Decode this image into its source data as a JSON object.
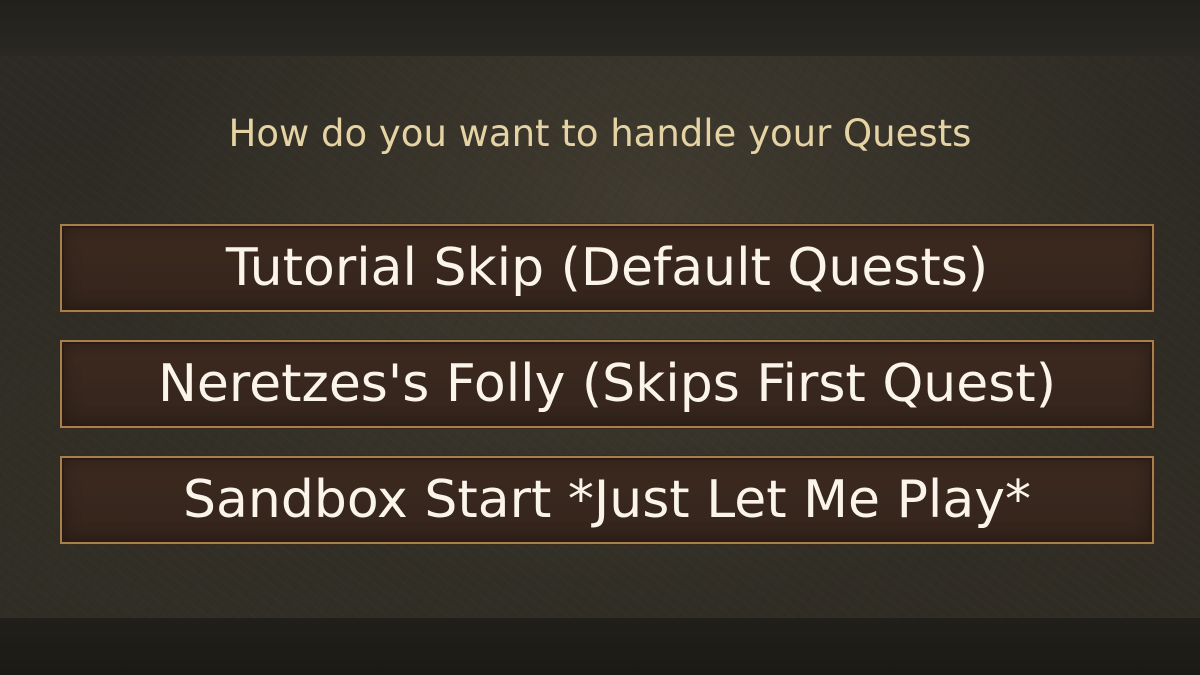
{
  "dialog": {
    "prompt": "How do you want to handle your Quests",
    "options": [
      {
        "label": "Tutorial Skip (Default Quests)"
      },
      {
        "label": "Neretzes's Folly (Skips First Quest)"
      },
      {
        "label": "Sandbox Start *Just Let Me Play*"
      }
    ]
  },
  "colors": {
    "prompt_text": "#e6d3a4",
    "option_text": "#fbf4ea",
    "option_border": "#a87f4c",
    "option_fill": "#3a281e",
    "background": "#2c2a23"
  }
}
